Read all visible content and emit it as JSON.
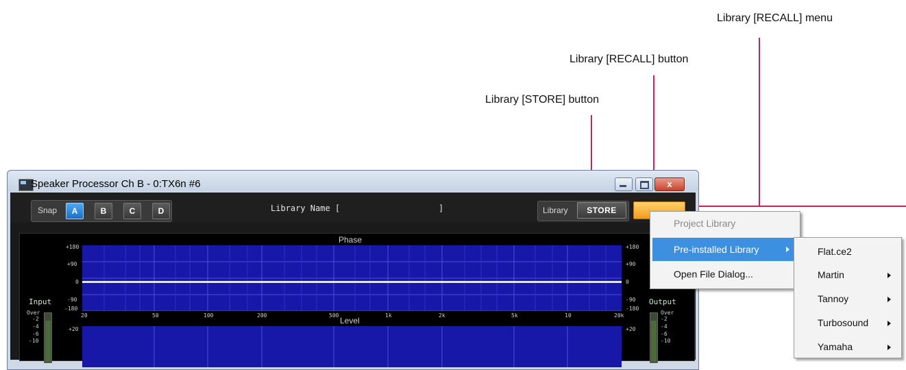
{
  "callouts": {
    "recall_menu": "Library [RECALL] menu",
    "recall_button": "Library [RECALL] button",
    "store_button": "Library [STORE] button"
  },
  "window": {
    "title": "Speaker Processor  Ch B - 0:TX6n #6",
    "close_glyph": "x"
  },
  "toolbar": {
    "snap_label": "Snap",
    "snap_buttons": [
      "A",
      "B",
      "C",
      "D"
    ],
    "snap_active": "A",
    "library_name_label": "Library Name [",
    "library_name_close": "]",
    "library_label": "Library",
    "store_label": "STORE",
    "recall_label": ""
  },
  "phase_graph": {
    "title": "Phase",
    "y_ticks_left": [
      "+180",
      "+90",
      "0",
      "-90",
      "-180"
    ],
    "y_ticks_right": [
      "+180",
      "+90",
      "0",
      "-90",
      "-180"
    ],
    "x_ticks": [
      "20",
      "50",
      "100",
      "200",
      "500",
      "1k",
      "2k",
      "5k",
      "10",
      "20k"
    ]
  },
  "level_graph": {
    "title": "Level",
    "y_top_left": "+20",
    "y_top_right": "+20"
  },
  "input_meter": {
    "label": "Input",
    "scale": [
      "Over",
      "-2",
      "-4",
      "-6",
      "-10"
    ]
  },
  "output_meter": {
    "label": "Output",
    "scale": [
      "Over",
      "-2",
      "-4",
      "-6",
      "-10"
    ]
  },
  "recall_menu": {
    "items": [
      "Project Library",
      "Pre-installed Library",
      "Open File Dialog..."
    ],
    "disabled_item": "Project Library",
    "highlighted_item": "Pre-installed Library"
  },
  "preinstalled_submenu": {
    "items": [
      "Flat.ce2",
      "Martin",
      "Tannoy",
      "Turbosound",
      "Yamaha"
    ]
  },
  "colors": {
    "callout_line": "#d81b4a",
    "graph_bg": "#1717a8",
    "menu_highlight": "#3d8fe0",
    "recall_button": "#f5a623",
    "snap_active": "#2f8de4"
  }
}
